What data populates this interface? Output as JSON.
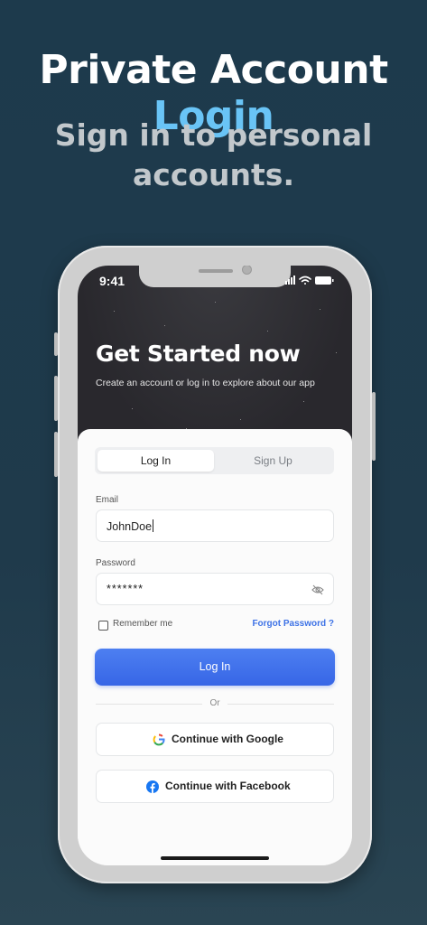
{
  "promo": {
    "headline_main": "Private Account",
    "headline_accent": "Login",
    "subheading": "Sign in to personal accounts."
  },
  "status_bar": {
    "time": "9:41",
    "icons": [
      "cellular-signal-icon",
      "wifi-icon",
      "battery-icon"
    ]
  },
  "hero": {
    "title": "Get Started now",
    "subtitle": "Create an account or log in to explore about our app"
  },
  "tabs": [
    {
      "label": "Log In",
      "active": true
    },
    {
      "label": "Sign Up",
      "active": false
    }
  ],
  "form": {
    "email_label": "Email",
    "email_value": "JohnDoe",
    "password_label": "Password",
    "password_value": "*******",
    "remember_label": "Remember me",
    "remember_checked": false,
    "forgot_label": "Forgot Password ?",
    "login_button": "Log In",
    "divider_text": "Or",
    "google_button": "Continue with Google",
    "facebook_button": "Continue with Facebook"
  },
  "colors": {
    "background": "#1f3a4b",
    "accent": "#69c4f6",
    "primary_button": "#3d72e6",
    "link": "#3d72e6"
  }
}
